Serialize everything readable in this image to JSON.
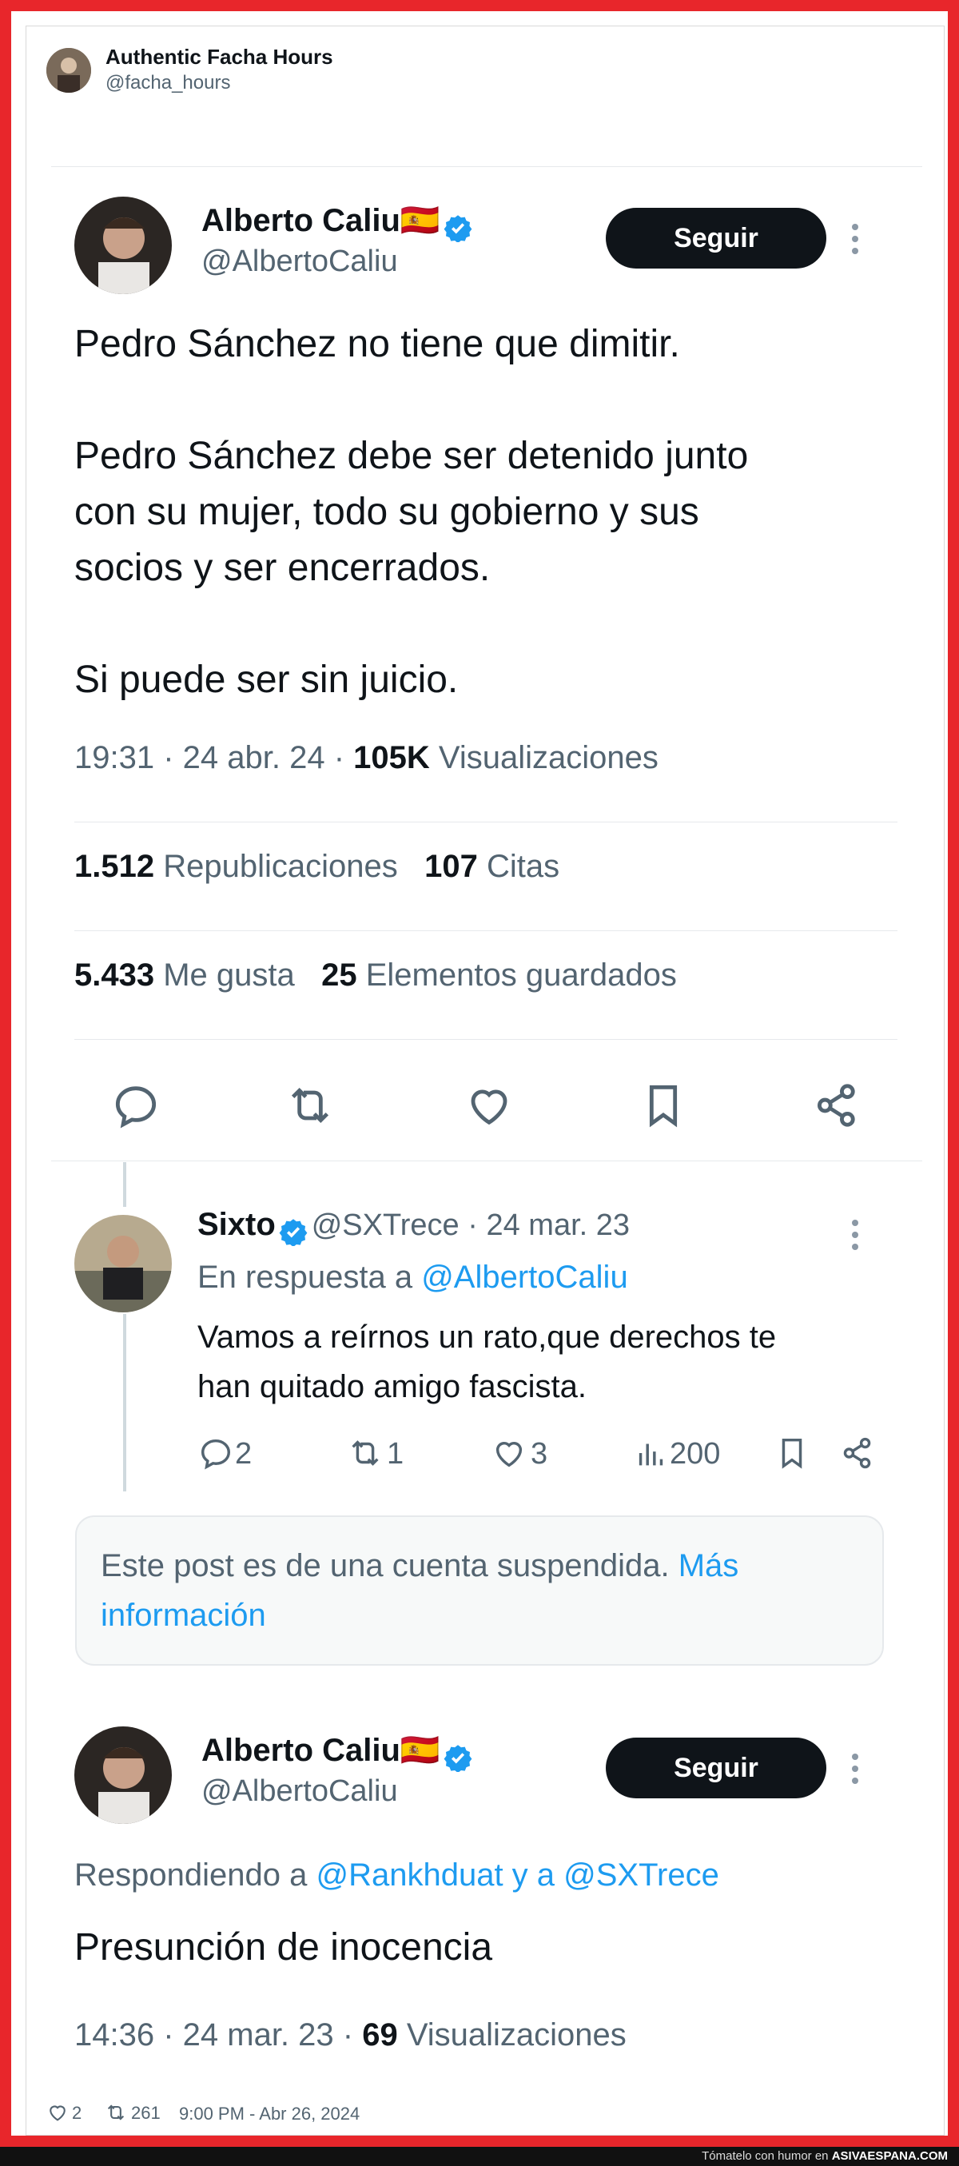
{
  "colors": {
    "frame": "#e8262b",
    "accent": "#1d9bf0",
    "text": "#0f1419",
    "muted": "#536471"
  },
  "outer": {
    "name": "Authentic Facha Hours",
    "handle": "@facha_hours",
    "likes": "2",
    "retweets": "261",
    "timestamp": "9:00 PM - Abr 26, 2024"
  },
  "tweet1": {
    "name": "Alberto Caliu",
    "flag": "🇪🇸",
    "handle": "@AlbertoCaliu",
    "follow_label": "Seguir",
    "lines": [
      "Pedro Sánchez no tiene que dimitir.",
      "Pedro Sánchez debe ser detenido junto",
      "con su mujer, todo su gobierno y sus",
      "socios y ser encerrados.",
      "Si puede ser sin juicio."
    ],
    "time": "19:31 · 24 abr. 24 · ",
    "views_count": "105K",
    "views_label": " Visualizaciones",
    "reposts_count": "1.512",
    "reposts_label": " Republicaciones",
    "quotes_count": "107",
    "quotes_label": " Citas",
    "likes_count": "5.433",
    "likes_label": " Me gusta",
    "saves_count": "25",
    "saves_label": " Elementos guardados",
    "actions": [
      "reply-icon",
      "repost-icon",
      "like-icon",
      "bookmark-icon",
      "share-icon"
    ]
  },
  "reply": {
    "name": "Sixto",
    "handle": "@SXTrece",
    "date": " · 24 mar. 23",
    "reply_prefix": "En respuesta a ",
    "reply_to": "@AlbertoCaliu",
    "line1": "Vamos a reírnos un rato,que derechos te",
    "line2": "han quitado amigo fascista.",
    "replies": "2",
    "reposts": "1",
    "likes": "3",
    "views": "200"
  },
  "suspended": {
    "text": "Este post es de una cuenta suspendida. ",
    "link1": "Más",
    "link2": "información"
  },
  "tweet2": {
    "name": "Alberto Caliu",
    "flag": "🇪🇸",
    "handle": "@AlbertoCaliu",
    "follow_label": "Seguir",
    "replying_prefix": "Respondiendo a ",
    "replying_to": "@Rankhduat y a @SXTrece",
    "text": "Presunción de inocencia",
    "time": "14:36 · 24 mar. 23 · ",
    "views_count": "69",
    "views_label": " Visualizaciones"
  },
  "footer": {
    "prefix": "Tómatelo con humor en ",
    "site": "ASIVAESPANA.COM"
  }
}
